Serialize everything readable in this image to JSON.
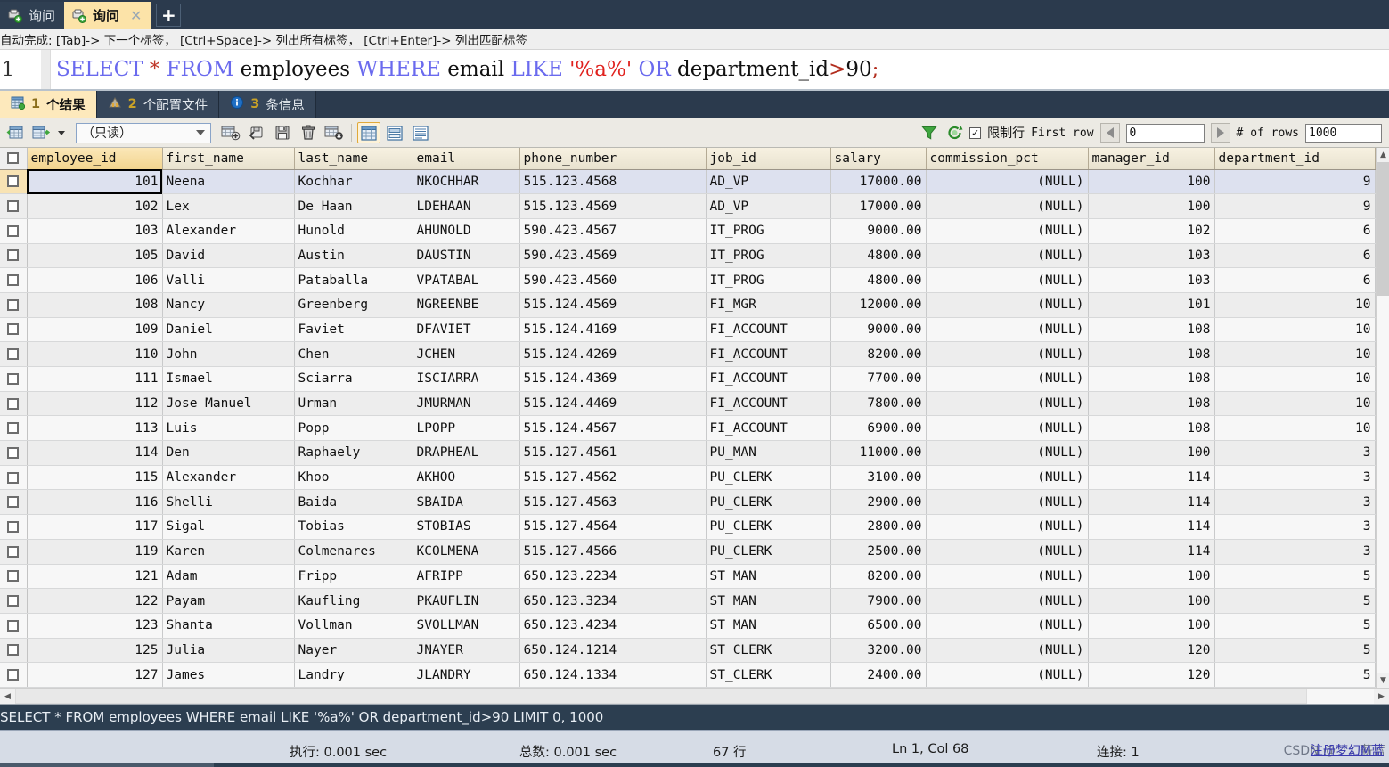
{
  "window": {
    "tabs": [
      {
        "label": "询问",
        "icon": "query-icon",
        "active": false,
        "closable": false
      },
      {
        "label": "询问",
        "icon": "query-icon",
        "active": true,
        "closable": true
      }
    ],
    "new_tab_label": "+"
  },
  "autocomplete_hint": {
    "prefix": "自动完成:",
    "parts": [
      {
        "key": "[Tab]->",
        "text": " 下一个标签，"
      },
      {
        "key": "[Ctrl+Space]->",
        "text": " 列出所有标签，"
      },
      {
        "key": "[Ctrl+Enter]->",
        "text": " 列出匹配标签"
      }
    ],
    "full": "自动完成: [Tab]-> 下一个标签， [Ctrl+Space]-> 列出所有标签， [Ctrl+Enter]-> 列出匹配标签"
  },
  "editor": {
    "line_number": "1",
    "sql_tokens": [
      {
        "t": "SELECT",
        "c": "kw"
      },
      {
        "t": " ",
        "c": "plain"
      },
      {
        "t": "*",
        "c": "op"
      },
      {
        "t": " ",
        "c": "plain"
      },
      {
        "t": "FROM",
        "c": "kw"
      },
      {
        "t": " employees ",
        "c": "plain"
      },
      {
        "t": "WHERE",
        "c": "kw"
      },
      {
        "t": " email ",
        "c": "plain"
      },
      {
        "t": "LIKE",
        "c": "kw"
      },
      {
        "t": " ",
        "c": "plain"
      },
      {
        "t": "'%a%'",
        "c": "str"
      },
      {
        "t": " ",
        "c": "plain"
      },
      {
        "t": "OR",
        "c": "kw"
      },
      {
        "t": " department_id",
        "c": "plain"
      },
      {
        "t": ">",
        "c": "punct"
      },
      {
        "t": "90",
        "c": "plain"
      },
      {
        "t": ";",
        "c": "punct"
      }
    ],
    "sql_plain": "SELECT * FROM employees WHERE email LIKE '%a%' OR department_id>90;"
  },
  "result_tabs": [
    {
      "num": "1",
      "label": "个结果",
      "icon": "result-grid-icon",
      "active": true
    },
    {
      "num": "2",
      "label": "个配置文件",
      "icon": "profile-icon",
      "active": false
    },
    {
      "num": "3",
      "label": "条信息",
      "icon": "info-icon",
      "active": false
    }
  ],
  "result_toolbar": {
    "grid_icon": "grid-icon",
    "export_icon": "export-grid-icon",
    "dropdown_caret": "chevron-down-icon",
    "view_mode": "（只读）",
    "buttons": [
      {
        "name": "insert-row-icon",
        "title": "插入行"
      },
      {
        "name": "revert-icon",
        "title": "撤销"
      },
      {
        "name": "save-icon",
        "title": "保存"
      },
      {
        "name": "delete-row-icon",
        "title": "删除行"
      },
      {
        "name": "discard-icon",
        "title": "丢弃"
      }
    ],
    "view_buttons": [
      {
        "name": "grid-view-icon",
        "selected": true
      },
      {
        "name": "form-view-icon",
        "selected": false
      },
      {
        "name": "field-view-icon",
        "selected": false
      }
    ],
    "filter_icon": "filter-icon",
    "refresh_icon": "refresh-icon",
    "limit_checkbox_checked": true,
    "limit_label": "限制行",
    "first_row_label": "First row",
    "first_row_value": "0",
    "rows_label": "# of rows",
    "rows_value": "1000",
    "prev_icon": "triangle-left-icon",
    "next_icon": "triangle-right-icon"
  },
  "grid": {
    "columns": [
      "employee_id",
      "first_name",
      "last_name",
      "email",
      "phone_number",
      "job_id",
      "salary",
      "commission_pct",
      "manager_id",
      "department_id"
    ],
    "rows": [
      [
        "101",
        "Neena",
        "Kochhar",
        "NKOCHHAR",
        "515.123.4568",
        "AD_VP",
        "17000.00",
        "(NULL)",
        "100",
        "9"
      ],
      [
        "102",
        "Lex",
        "De Haan",
        "LDEHAAN",
        "515.123.4569",
        "AD_VP",
        "17000.00",
        "(NULL)",
        "100",
        "9"
      ],
      [
        "103",
        "Alexander",
        "Hunold",
        "AHUNOLD",
        "590.423.4567",
        "IT_PROG",
        "9000.00",
        "(NULL)",
        "102",
        "6"
      ],
      [
        "105",
        "David",
        "Austin",
        "DAUSTIN",
        "590.423.4569",
        "IT_PROG",
        "4800.00",
        "(NULL)",
        "103",
        "6"
      ],
      [
        "106",
        "Valli",
        "Pataballa",
        "VPATABAL",
        "590.423.4560",
        "IT_PROG",
        "4800.00",
        "(NULL)",
        "103",
        "6"
      ],
      [
        "108",
        "Nancy",
        "Greenberg",
        "NGREENBE",
        "515.124.4569",
        "FI_MGR",
        "12000.00",
        "(NULL)",
        "101",
        "10"
      ],
      [
        "109",
        "Daniel",
        "Faviet",
        "DFAVIET",
        "515.124.4169",
        "FI_ACCOUNT",
        "9000.00",
        "(NULL)",
        "108",
        "10"
      ],
      [
        "110",
        "John",
        "Chen",
        "JCHEN",
        "515.124.4269",
        "FI_ACCOUNT",
        "8200.00",
        "(NULL)",
        "108",
        "10"
      ],
      [
        "111",
        "Ismael",
        "Sciarra",
        "ISCIARRA",
        "515.124.4369",
        "FI_ACCOUNT",
        "7700.00",
        "(NULL)",
        "108",
        "10"
      ],
      [
        "112",
        "Jose Manuel",
        "Urman",
        "JMURMAN",
        "515.124.4469",
        "FI_ACCOUNT",
        "7800.00",
        "(NULL)",
        "108",
        "10"
      ],
      [
        "113",
        "Luis",
        "Popp",
        "LPOPP",
        "515.124.4567",
        "FI_ACCOUNT",
        "6900.00",
        "(NULL)",
        "108",
        "10"
      ],
      [
        "114",
        "Den",
        "Raphaely",
        "DRAPHEAL",
        "515.127.4561",
        "PU_MAN",
        "11000.00",
        "(NULL)",
        "100",
        "3"
      ],
      [
        "115",
        "Alexander",
        "Khoo",
        "AKHOO",
        "515.127.4562",
        "PU_CLERK",
        "3100.00",
        "(NULL)",
        "114",
        "3"
      ],
      [
        "116",
        "Shelli",
        "Baida",
        "SBAIDA",
        "515.127.4563",
        "PU_CLERK",
        "2900.00",
        "(NULL)",
        "114",
        "3"
      ],
      [
        "117",
        "Sigal",
        "Tobias",
        "STOBIAS",
        "515.127.4564",
        "PU_CLERK",
        "2800.00",
        "(NULL)",
        "114",
        "3"
      ],
      [
        "119",
        "Karen",
        "Colmenares",
        "KCOLMENA",
        "515.127.4566",
        "PU_CLERK",
        "2500.00",
        "(NULL)",
        "114",
        "3"
      ],
      [
        "121",
        "Adam",
        "Fripp",
        "AFRIPP",
        "650.123.2234",
        "ST_MAN",
        "8200.00",
        "(NULL)",
        "100",
        "5"
      ],
      [
        "122",
        "Payam",
        "Kaufling",
        "PKAUFLIN",
        "650.123.3234",
        "ST_MAN",
        "7900.00",
        "(NULL)",
        "100",
        "5"
      ],
      [
        "123",
        "Shanta",
        "Vollman",
        "SVOLLMAN",
        "650.123.4234",
        "ST_MAN",
        "6500.00",
        "(NULL)",
        "100",
        "5"
      ],
      [
        "125",
        "Julia",
        "Nayer",
        "JNAYER",
        "650.124.1214",
        "ST_CLERK",
        "3200.00",
        "(NULL)",
        "120",
        "5"
      ],
      [
        "127",
        "James",
        "Landry",
        "JLANDRY",
        "650.124.1334",
        "ST_CLERK",
        "2400.00",
        "(NULL)",
        "120",
        "5"
      ]
    ],
    "selected_row_index": 0,
    "focused_cell": {
      "row": 0,
      "col": 0
    }
  },
  "sql_bar": {
    "text": "SELECT * FROM employees WHERE email LIKE '%a%' OR department_id>90 LIMIT 0, 1000"
  },
  "status_bar": {
    "exec_label": "执行: 0.001 sec",
    "total_label": "总数: 0.001 sec",
    "rows_label": "67 行",
    "cursor_label": "Ln 1, Col 68",
    "connection_label": "连接: 1",
    "watermark": "CSDN @梦幻薪蓝",
    "watermark_overlay": "注册梦幻M蓝"
  },
  "colors": {
    "tab_active_bg": "#fce3a8",
    "tabbar_bg": "#2b3a4d",
    "sql_bar_bg": "#2c3e50",
    "keyword": "#6a6aee",
    "string": "#e0211d",
    "header_first": "#f2d48e",
    "selected_row": "#dde1ef",
    "status_bg": "#d6dce6"
  }
}
